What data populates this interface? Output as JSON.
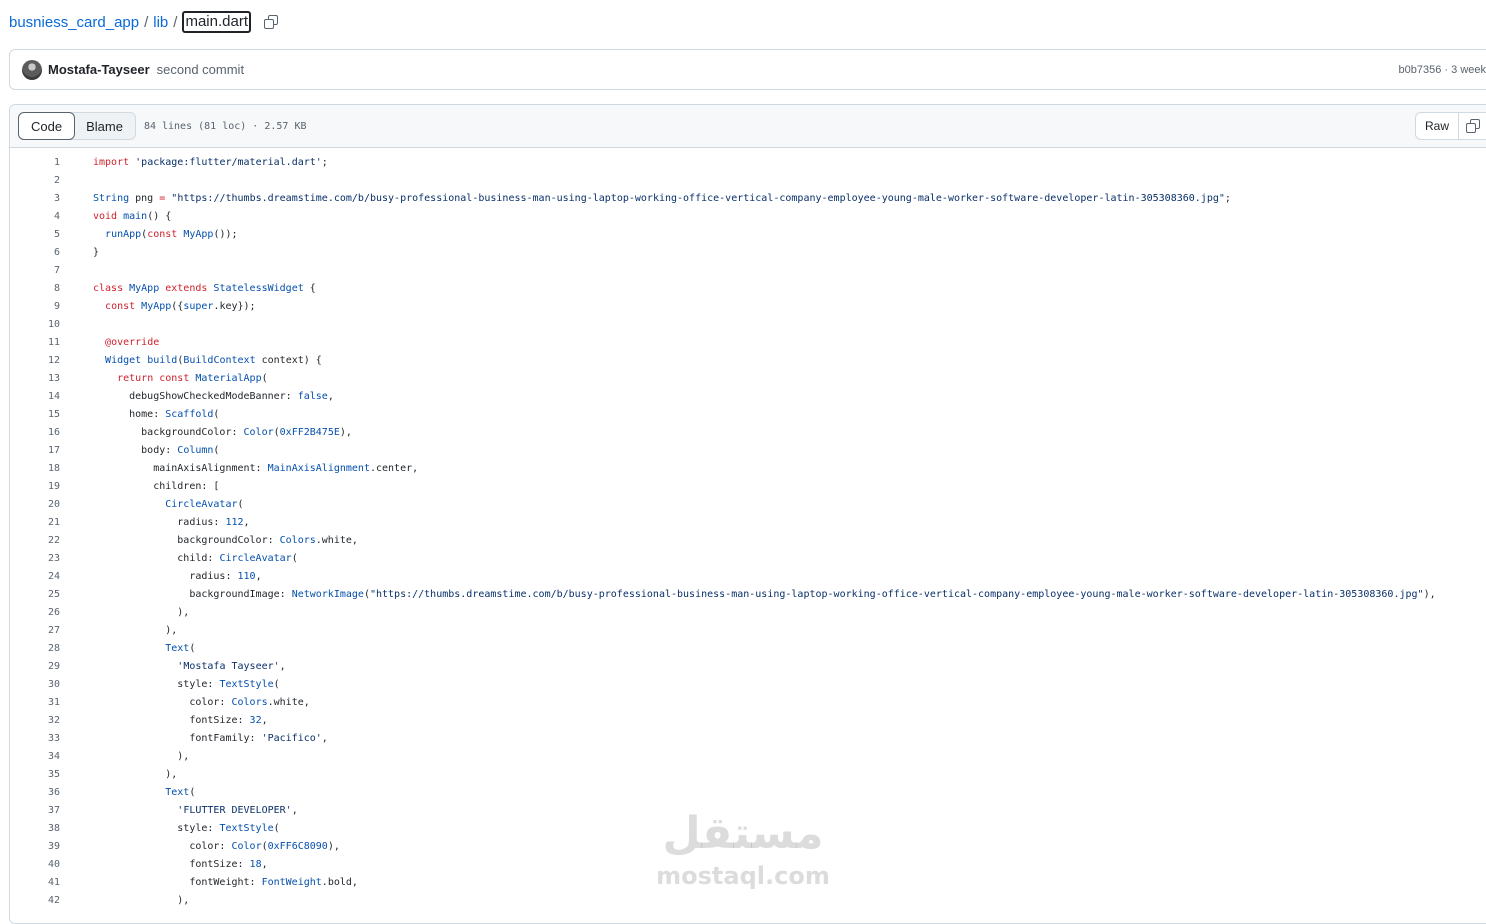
{
  "breadcrumb": {
    "repo": "busniess_card_app",
    "folder": "lib",
    "separator": "/",
    "file": "main.dart",
    "copy_icon": "copy-icon"
  },
  "commit": {
    "author": "Mostafa-Tayseer",
    "message": "second commit",
    "meta": "b0b7356 · 3 week"
  },
  "file_header": {
    "tabs": [
      "Code",
      "Blame"
    ],
    "active_tab": "Code",
    "info": "84 lines (81 loc) · 2.57 KB",
    "raw_label": "Raw"
  },
  "code": {
    "lines": [
      {
        "n": "1",
        "t": [
          [
            "k",
            "import "
          ],
          [
            "s",
            "'package:flutter/material.dart'"
          ],
          [
            "p",
            ";"
          ]
        ]
      },
      {
        "n": "2",
        "t": []
      },
      {
        "n": "3",
        "t": [
          [
            "t",
            "String"
          ],
          [
            "p",
            " png "
          ],
          [
            "k",
            "="
          ],
          [
            "p",
            " "
          ],
          [
            "s",
            "\"https://thumbs.dreamstime.com/b/busy-professional-business-man-using-laptop-working-office-vertical-company-employee-young-male-worker-software-developer-latin-305308360.jpg\""
          ],
          [
            "p",
            ";"
          ]
        ]
      },
      {
        "n": "4",
        "t": [
          [
            "k",
            "void "
          ],
          [
            "t",
            "main"
          ],
          [
            "p",
            "() {"
          ]
        ]
      },
      {
        "n": "5",
        "t": [
          [
            "p",
            "  "
          ],
          [
            "t",
            "runApp"
          ],
          [
            "p",
            "("
          ],
          [
            "k",
            "const "
          ],
          [
            "t",
            "MyApp"
          ],
          [
            "p",
            "());"
          ]
        ]
      },
      {
        "n": "6",
        "t": [
          [
            "p",
            "}"
          ]
        ]
      },
      {
        "n": "7",
        "t": []
      },
      {
        "n": "8",
        "t": [
          [
            "k",
            "class "
          ],
          [
            "t",
            "MyApp "
          ],
          [
            "k",
            "extends "
          ],
          [
            "t",
            "StatelessWidget"
          ],
          [
            "p",
            " {"
          ]
        ]
      },
      {
        "n": "9",
        "t": [
          [
            "p",
            "  "
          ],
          [
            "k",
            "const "
          ],
          [
            "t",
            "MyApp"
          ],
          [
            "p",
            "({"
          ],
          [
            "t",
            "super"
          ],
          [
            "p",
            ".key});"
          ]
        ]
      },
      {
        "n": "10",
        "t": []
      },
      {
        "n": "11",
        "t": [
          [
            "p",
            "  "
          ],
          [
            "k",
            "@override"
          ]
        ]
      },
      {
        "n": "12",
        "t": [
          [
            "p",
            "  "
          ],
          [
            "t",
            "Widget "
          ],
          [
            "t",
            "build"
          ],
          [
            "p",
            "("
          ],
          [
            "t",
            "BuildContext"
          ],
          [
            "p",
            " context) {"
          ]
        ]
      },
      {
        "n": "13",
        "t": [
          [
            "p",
            "    "
          ],
          [
            "k",
            "return const "
          ],
          [
            "t",
            "MaterialApp"
          ],
          [
            "p",
            "("
          ]
        ]
      },
      {
        "n": "14",
        "t": [
          [
            "p",
            "      debugShowCheckedModeBanner: "
          ],
          [
            "t",
            "false"
          ],
          [
            "p",
            ","
          ]
        ]
      },
      {
        "n": "15",
        "t": [
          [
            "p",
            "      home: "
          ],
          [
            "t",
            "Scaffold"
          ],
          [
            "p",
            "("
          ]
        ]
      },
      {
        "n": "16",
        "t": [
          [
            "p",
            "        backgroundColor: "
          ],
          [
            "t",
            "Color"
          ],
          [
            "p",
            "("
          ],
          [
            "t",
            "0xFF2B475E"
          ],
          [
            "p",
            "),"
          ]
        ]
      },
      {
        "n": "17",
        "t": [
          [
            "p",
            "        body: "
          ],
          [
            "t",
            "Column"
          ],
          [
            "p",
            "("
          ]
        ]
      },
      {
        "n": "18",
        "t": [
          [
            "p",
            "          mainAxisAlignment: "
          ],
          [
            "t",
            "MainAxisAlignment"
          ],
          [
            "p",
            ".center,"
          ]
        ]
      },
      {
        "n": "19",
        "t": [
          [
            "p",
            "          children: ["
          ]
        ]
      },
      {
        "n": "20",
        "t": [
          [
            "p",
            "            "
          ],
          [
            "t",
            "CircleAvatar"
          ],
          [
            "p",
            "("
          ]
        ]
      },
      {
        "n": "21",
        "t": [
          [
            "p",
            "              radius: "
          ],
          [
            "t",
            "112"
          ],
          [
            "p",
            ","
          ]
        ]
      },
      {
        "n": "22",
        "t": [
          [
            "p",
            "              backgroundColor: "
          ],
          [
            "t",
            "Colors"
          ],
          [
            "p",
            ".white,"
          ]
        ]
      },
      {
        "n": "23",
        "t": [
          [
            "p",
            "              child: "
          ],
          [
            "t",
            "CircleAvatar"
          ],
          [
            "p",
            "("
          ]
        ]
      },
      {
        "n": "24",
        "t": [
          [
            "p",
            "                radius: "
          ],
          [
            "t",
            "110"
          ],
          [
            "p",
            ","
          ]
        ]
      },
      {
        "n": "25",
        "t": [
          [
            "p",
            "                backgroundImage: "
          ],
          [
            "t",
            "NetworkImage"
          ],
          [
            "p",
            "("
          ],
          [
            "s",
            "\"https://thumbs.dreamstime.com/b/busy-professional-business-man-using-laptop-working-office-vertical-company-employee-young-male-worker-software-developer-latin-305308360.jpg\""
          ],
          [
            "p",
            "),"
          ]
        ]
      },
      {
        "n": "26",
        "t": [
          [
            "p",
            "              ),"
          ]
        ]
      },
      {
        "n": "27",
        "t": [
          [
            "p",
            "            ),"
          ]
        ]
      },
      {
        "n": "28",
        "t": [
          [
            "p",
            "            "
          ],
          [
            "t",
            "Text"
          ],
          [
            "p",
            "("
          ]
        ]
      },
      {
        "n": "29",
        "t": [
          [
            "p",
            "              "
          ],
          [
            "s",
            "'Mostafa Tayseer'"
          ],
          [
            "p",
            ","
          ]
        ]
      },
      {
        "n": "30",
        "t": [
          [
            "p",
            "              style: "
          ],
          [
            "t",
            "TextStyle"
          ],
          [
            "p",
            "("
          ]
        ]
      },
      {
        "n": "31",
        "t": [
          [
            "p",
            "                color: "
          ],
          [
            "t",
            "Colors"
          ],
          [
            "p",
            ".white,"
          ]
        ]
      },
      {
        "n": "32",
        "t": [
          [
            "p",
            "                fontSize: "
          ],
          [
            "t",
            "32"
          ],
          [
            "p",
            ","
          ]
        ]
      },
      {
        "n": "33",
        "t": [
          [
            "p",
            "                fontFamily: "
          ],
          [
            "s",
            "'Pacifico'"
          ],
          [
            "p",
            ","
          ]
        ]
      },
      {
        "n": "34",
        "t": [
          [
            "p",
            "              ),"
          ]
        ]
      },
      {
        "n": "35",
        "t": [
          [
            "p",
            "            ),"
          ]
        ]
      },
      {
        "n": "36",
        "t": [
          [
            "p",
            "            "
          ],
          [
            "t",
            "Text"
          ],
          [
            "p",
            "("
          ]
        ]
      },
      {
        "n": "37",
        "t": [
          [
            "p",
            "              "
          ],
          [
            "s",
            "'FLUTTER DEVELOPER'"
          ],
          [
            "p",
            ","
          ]
        ]
      },
      {
        "n": "38",
        "t": [
          [
            "p",
            "              style: "
          ],
          [
            "t",
            "TextStyle"
          ],
          [
            "p",
            "("
          ]
        ]
      },
      {
        "n": "39",
        "t": [
          [
            "p",
            "                color: "
          ],
          [
            "t",
            "Color"
          ],
          [
            "p",
            "("
          ],
          [
            "t",
            "0xFF6C8090"
          ],
          [
            "p",
            "),"
          ]
        ]
      },
      {
        "n": "40",
        "t": [
          [
            "p",
            "                fontSize: "
          ],
          [
            "t",
            "18"
          ],
          [
            "p",
            ","
          ]
        ]
      },
      {
        "n": "41",
        "t": [
          [
            "p",
            "                fontWeight: "
          ],
          [
            "t",
            "FontWeight"
          ],
          [
            "p",
            ".bold,"
          ]
        ]
      },
      {
        "n": "42",
        "t": [
          [
            "p",
            "              ),"
          ]
        ]
      }
    ]
  },
  "watermark": {
    "arabic": "مستقل",
    "latin": "mostaql.com"
  },
  "colors": {
    "link": "#0969da",
    "keyword": "#cf222e",
    "type": "#0550ae",
    "string": "#0a3069",
    "muted": "#59636e"
  }
}
